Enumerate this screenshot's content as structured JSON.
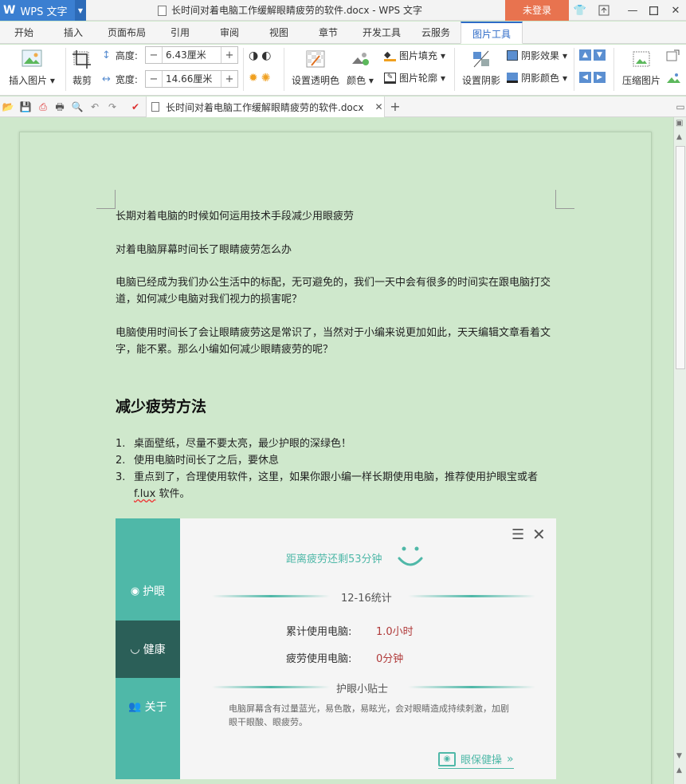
{
  "titlebar": {
    "app_name": "WPS 文字",
    "window_title": "长时间对着电脑工作缓解眼睛疲劳的软件.docx - WPS 文字",
    "login_label": "未登录"
  },
  "tabs": [
    "开始",
    "插入",
    "页面布局",
    "引用",
    "审阅",
    "视图",
    "章节",
    "开发工具",
    "云服务",
    "图片工具"
  ],
  "ribbon": {
    "insert_picture": "插入图片",
    "crop": "裁剪",
    "height_label": "高度:",
    "height_value": "6.43厘米",
    "width_label": "宽度:",
    "width_value": "14.66厘米",
    "set_transparent": "设置透明色",
    "color": "颜色",
    "picture_fill": "图片填充",
    "picture_outline": "图片轮廓",
    "set_shadow": "设置阴影",
    "shadow_effect": "阴影效果",
    "shadow_color": "阴影颜色",
    "compress_picture": "压缩图片"
  },
  "doc_tab": {
    "title": "长时间对着电脑工作缓解眼睛疲劳的软件.docx"
  },
  "document": {
    "p1": "长期对着电脑的时候如何运用技术手段减少用眼疲劳",
    "p2": "对着电脑屏幕时间长了眼睛疲劳怎么办",
    "p3": "电脑已经成为我们办公生活中的标配，无可避免的，我们一天中会有很多的时间实在跟电脑打交道，如何减少电脑对我们视力的损害呢？",
    "p4": "电脑使用时间长了会让眼睛疲劳这是常识了，当然对于小编来说更加如此，天天编辑文章看着文字，能不累。那么小编如何减少眼睛疲劳的呢？",
    "heading": "减少疲劳方法",
    "list": [
      {
        "num": "1.",
        "text": "桌面壁纸，尽量不要太亮，最少护眼的深绿色！"
      },
      {
        "num": "2.",
        "text": "使用电脑时间长了之后，要休息"
      },
      {
        "num": "3.",
        "text_before": "重点到了，合理使用软件，这里，如果你跟小编一样长期使用电脑，推荐使用护眼宝或者 ",
        "text_wavy": "f.lux",
        "text_after": " 软件。"
      }
    ]
  },
  "app_image": {
    "side": [
      "护眼",
      "健康",
      "关于"
    ],
    "countdown": "距离疲劳还剩53分钟",
    "stats_title": "12-16统计",
    "cumulative_label": "累计使用电脑:",
    "cumulative_value": "1.0小时",
    "fatigue_label": "疲劳使用电脑:",
    "fatigue_value": "0分钟",
    "tips_title": "护眼小贴士",
    "tips_text": "电脑屏幕含有过量蓝光，易色散，易眩光，会对眼睛造成持续刺激，加剧眼干眼酸、眼疲劳。",
    "exercise_link": "眼保健操"
  },
  "colors": {
    "accent": "#2e6bc7",
    "login": "#e8734f",
    "page_bg": "#cfe8cc",
    "teal": "#4fb8a8",
    "dark_teal": "#2b5f58",
    "value_red": "#b03a3a"
  }
}
